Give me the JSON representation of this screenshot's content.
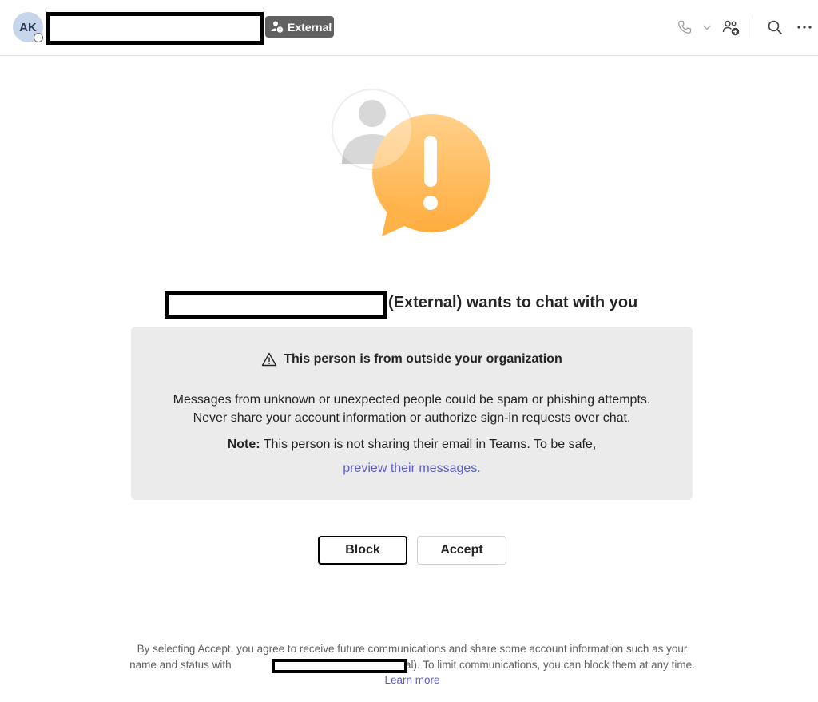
{
  "header": {
    "avatar_initials": "AK",
    "external_badge": "External",
    "icons": [
      "call-icon",
      "chevron-down-icon",
      "add-people-icon",
      "search-icon",
      "more-options-icon"
    ]
  },
  "main": {
    "title_suffix": "(External) wants to chat with you",
    "notice": {
      "heading": "This person is from outside your organization",
      "body_line1": "Messages from unknown or unexpected people could be spam or phishing attempts.",
      "body_line2": "Never share your account information or authorize sign-in requests over chat.",
      "note_label": "Note:",
      "note_text": " This person is not sharing their email in Teams. To be safe,",
      "link": "preview their messages."
    },
    "buttons": {
      "block": "Block",
      "accept": "Accept"
    }
  },
  "footer": {
    "text_part1": "By selecting Accept, you agree to receive future communications and share some account information such as your name and status with",
    "text_part2": "(External). To limit communications, you can block them at any time.",
    "learn_more": "Learn more"
  },
  "colors": {
    "accent": "#5b5fc7",
    "badge_bg": "#616161",
    "notice_bg": "#ebebeb",
    "warning_orange": "#ffb84d"
  }
}
